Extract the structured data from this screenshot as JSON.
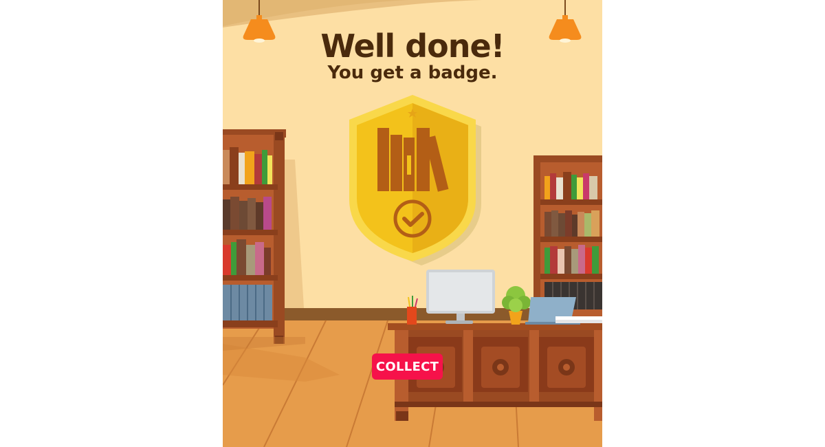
{
  "message": {
    "headline": "Well done!",
    "subline": "You get a badge."
  },
  "badge": {
    "icon": "books-shield-check-badge-icon",
    "colors": {
      "shield": "#f3c21b",
      "shield_edge": "#e6a417",
      "emblem": "#b35e16"
    }
  },
  "actions": {
    "collect_label": "COLLECT"
  },
  "colors": {
    "wall": "#fddfa4",
    "floor": "#e39b4a",
    "wood": "#9a4a22",
    "button": "#f6124a"
  }
}
